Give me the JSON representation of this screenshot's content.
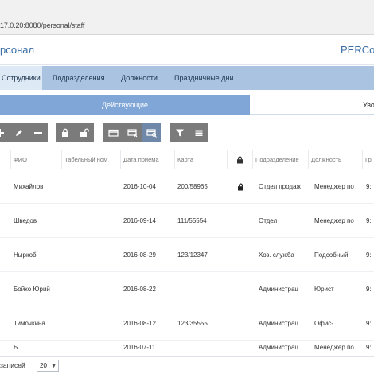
{
  "browser": {
    "url": "17.0.20:8080/personal/staff"
  },
  "app": {
    "title": "рсонал",
    "brand": "PERCo"
  },
  "tabs": [
    {
      "label": "Сотрудники",
      "active": true
    },
    {
      "label": "Подразделения",
      "active": false
    },
    {
      "label": "Должности",
      "active": false
    },
    {
      "label": "Праздничные дни",
      "active": false
    }
  ],
  "subtabs": {
    "active": "Действующие",
    "other": "Уво"
  },
  "toolbar": {
    "icons": [
      "add-icon",
      "edit-icon",
      "remove-icon",
      "lock-icon",
      "unlock-icon",
      "card-icon",
      "card-remove-icon",
      "card-search-icon",
      "filter-icon",
      "list-icon"
    ]
  },
  "table": {
    "columns": [
      "ФИО",
      "Табельный ном",
      "Дата приема",
      "Карта",
      "lock-icon",
      "Подразделение",
      "Должность",
      "Гр"
    ],
    "rows": [
      {
        "name": "Михайлов",
        "tab_no": "",
        "date": "2016-10-04",
        "card": "200/58965",
        "locked": true,
        "dept": "Отдел продаж",
        "position": "Менеджер по",
        "graph": "9:"
      },
      {
        "name": "Шведов",
        "tab_no": "",
        "date": "2016-09-14",
        "card": "111/55554",
        "locked": false,
        "dept": "Отдел",
        "position": "Менеджер по",
        "graph": "9:"
      },
      {
        "name": "Ныркоб",
        "tab_no": "",
        "date": "2016-08-29",
        "card": "123/12347",
        "locked": false,
        "dept": "Хоз. служба",
        "position": "Подсобный",
        "graph": "9:"
      },
      {
        "name": "Бойко Юрий",
        "tab_no": "",
        "date": "2016-08-22",
        "card": "",
        "locked": false,
        "dept": "Администрац",
        "position": "Юрист",
        "graph": "9:"
      },
      {
        "name": "Тимочкина",
        "tab_no": "",
        "date": "2016-08-12",
        "card": "123/35555",
        "locked": false,
        "dept": "Администрац",
        "position": "Офис-",
        "graph": "9:"
      },
      {
        "name": "Б......",
        "tab_no": "",
        "date": "2016-07-11",
        "card": "",
        "locked": false,
        "dept": "Администрац",
        "position": "Менеджер по",
        "graph": "9:"
      }
    ]
  },
  "footer": {
    "label": "записей",
    "page_size": "20"
  },
  "colors": {
    "accent": "#3a6ea5",
    "tab_bar": "#a9c3e0",
    "subtab_active": "#7fa6d6",
    "toolbar_button": "#7b7b7b"
  }
}
